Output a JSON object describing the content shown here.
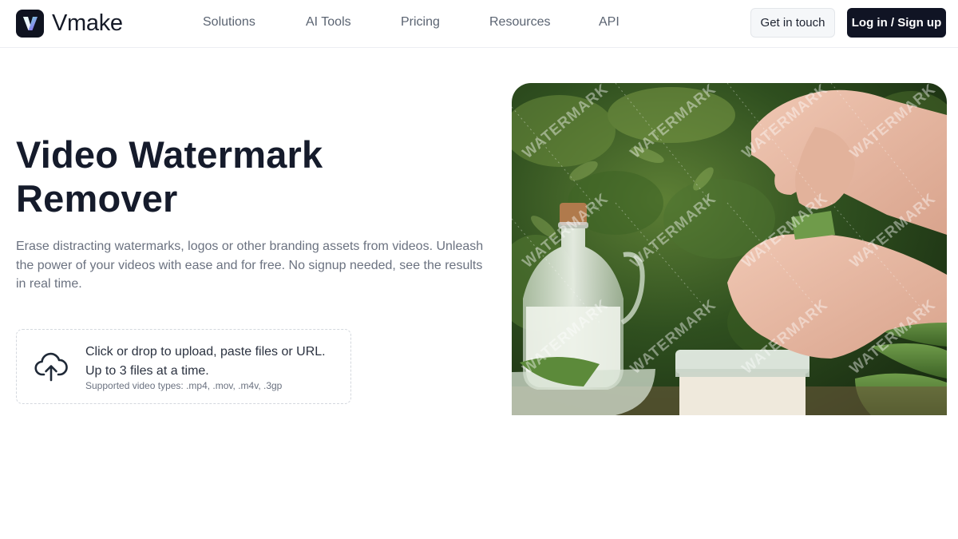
{
  "header": {
    "logo_text": "Vmake",
    "nav": [
      {
        "label": "Solutions"
      },
      {
        "label": "AI Tools"
      },
      {
        "label": "Pricing"
      },
      {
        "label": "Resources"
      },
      {
        "label": "API"
      }
    ],
    "contact_label": "Get in touch",
    "login_label": "Log in / Sign up"
  },
  "hero": {
    "title_line1": "Video Watermark",
    "title_line2": "Remover",
    "description": "Erase distracting watermarks, logos or other branding assets from videos. Unleash the power of your videos with ease and for free. No signup needed, see the results in real time."
  },
  "upload": {
    "main_text": "Click or drop to upload, paste files or URL. Up to 3 files at a time.",
    "sub_text": "Supported video types: .mp4, .mov, .m4v, .3gp",
    "icon": "cloud-upload-icon"
  },
  "image": {
    "watermark_text": "WATERMARK"
  },
  "colors": {
    "primary_dark": "#101424",
    "text_muted": "#6b7280",
    "logo_gradient_start": "#7cf7d4",
    "logo_gradient_end": "#8b5cf6"
  }
}
